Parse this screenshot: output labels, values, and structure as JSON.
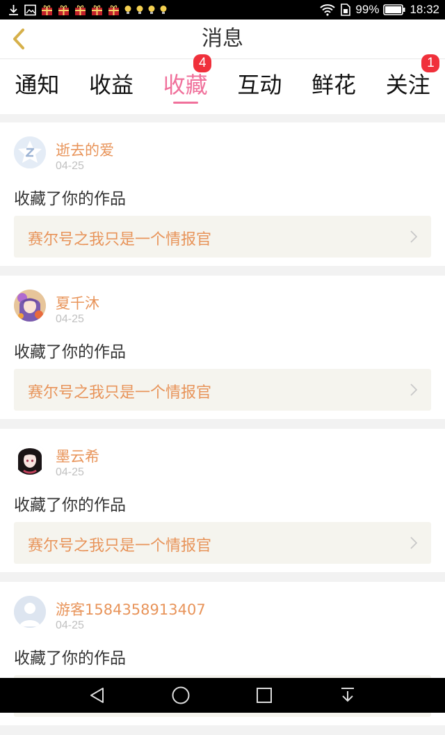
{
  "status_bar": {
    "battery": "99%",
    "time": "18:32",
    "left_icons": [
      "download-icon",
      "image-icon",
      "gift-icon",
      "gift-icon",
      "gift-icon",
      "gift-icon",
      "gift-icon",
      "bulb-icon",
      "bulb-icon",
      "bulb-icon",
      "bulb-icon"
    ],
    "right_icons": [
      "wifi-icon",
      "sim-icon",
      "battery-icon"
    ]
  },
  "header": {
    "title": "消息",
    "back_icon": "chevron-left-icon"
  },
  "tabs": [
    {
      "label": "通知",
      "active": false,
      "badge": ""
    },
    {
      "label": "收益",
      "active": false,
      "badge": ""
    },
    {
      "label": "收藏",
      "active": true,
      "badge": "4"
    },
    {
      "label": "互动",
      "active": false,
      "badge": ""
    },
    {
      "label": "鲜花",
      "active": false,
      "badge": ""
    },
    {
      "label": "关注",
      "active": false,
      "badge": "1"
    }
  ],
  "notifications": [
    {
      "user": "逝去的爱",
      "date": "04-25",
      "action": "收藏了你的作品",
      "work": "赛尔号之我只是一个情报官",
      "avatar": "default-star-avatar"
    },
    {
      "user": "夏千沐",
      "date": "04-25",
      "action": "收藏了你的作品",
      "work": "赛尔号之我只是一个情报官",
      "avatar": "anime-girl-avatar"
    },
    {
      "user": "墨云希",
      "date": "04-25",
      "action": "收藏了你的作品",
      "work": "赛尔号之我只是一个情报官",
      "avatar": "dark-hair-avatar"
    },
    {
      "user": "游客1584358913407",
      "date": "04-25",
      "action": "收藏了你的作品",
      "work": "",
      "avatar": "guest-person-avatar"
    }
  ],
  "colors": {
    "accent_pink": "#f0709b",
    "orange_text": "#e8945a",
    "badge_red": "#f0303b"
  },
  "nav_bar": {
    "icons": [
      "back-triangle-icon",
      "home-circle-icon",
      "recents-square-icon",
      "collapse-icon"
    ]
  }
}
